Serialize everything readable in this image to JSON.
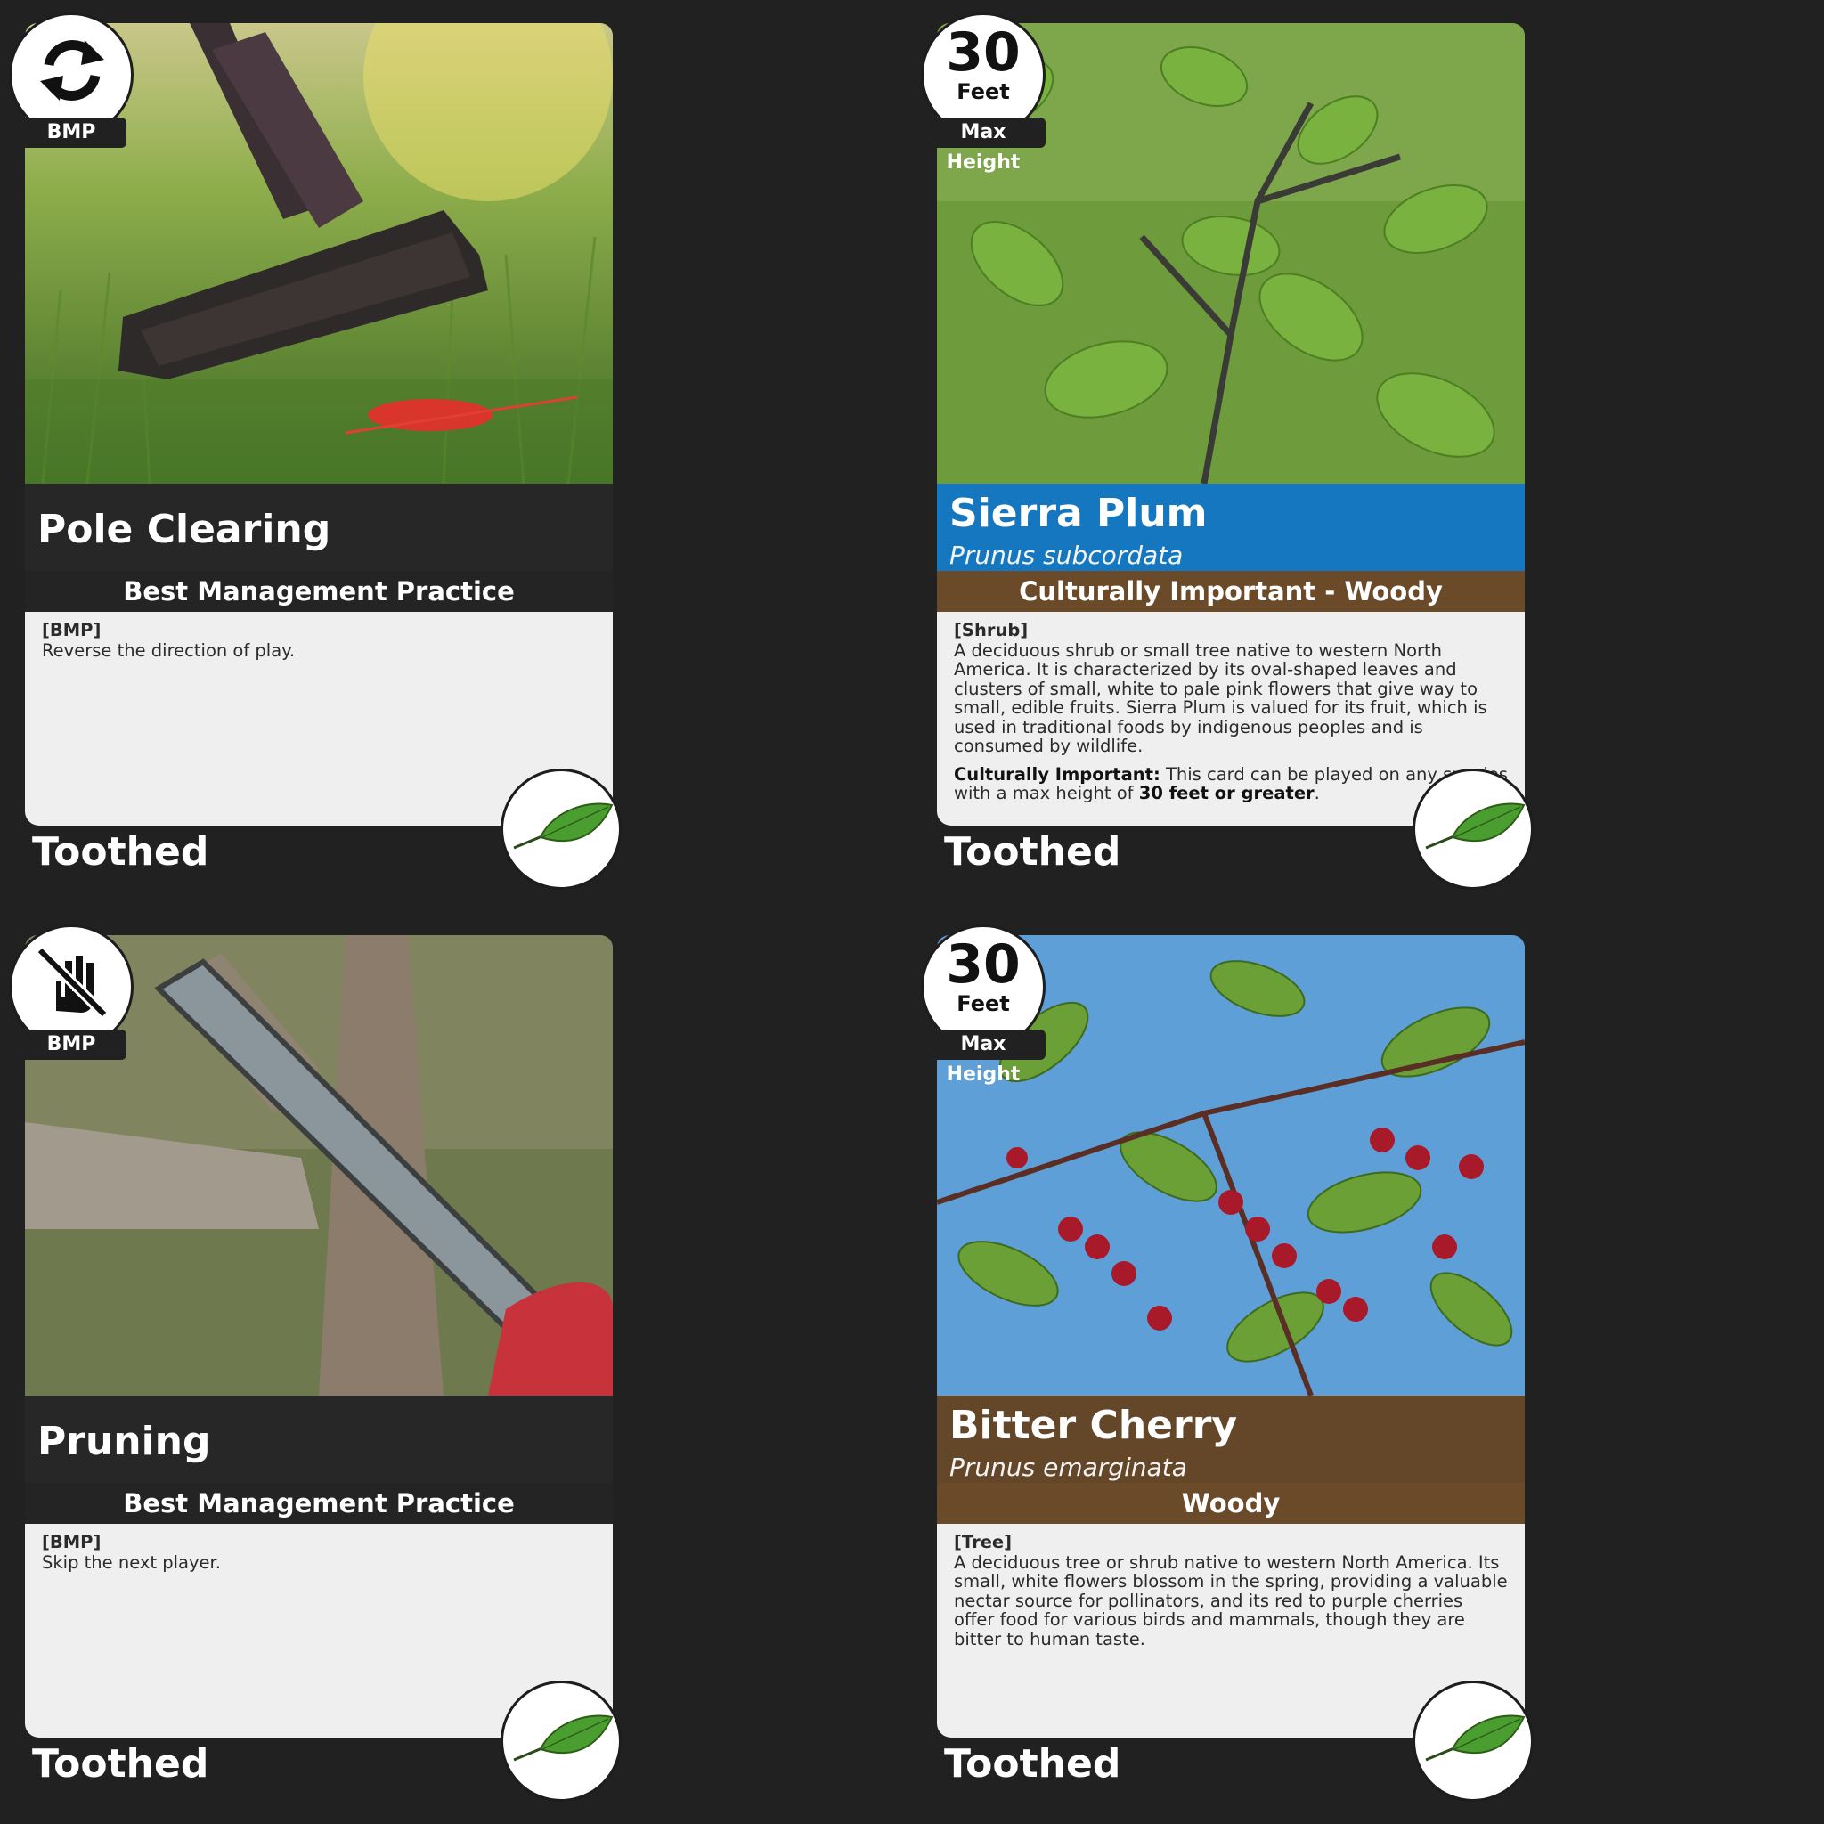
{
  "cards": [
    {
      "title": "Pole Clearing",
      "type_label": "Best Management Practice",
      "tag": "[BMP]",
      "text": "Reverse the direction of play.",
      "corner_icon": "reverse-arrows-icon",
      "corner_label": "BMP",
      "bottom_label": "Toothed"
    },
    {
      "title": "Sierra Plum",
      "scientific_name": "Prunus subcordata",
      "type_label": "Culturally Important - Woody",
      "tag": "[Shrub]",
      "text": "A deciduous shrub or small tree native to western North America. It is characterized by its oval-shaped leaves and clusters of small, white to pale pink flowers that give way to small, edible fruits. Sierra Plum is valued for its fruit, which is used in traditional foods by indigenous peoples and is consumed by wildlife.",
      "cultural_label": "Culturally Important:",
      "cultural_text": "This card can be played on any species with a max height of",
      "cultural_bold": "30 feet or greater",
      "cultural_end": ".",
      "height_value": "30",
      "height_unit": "Feet",
      "corner_label": "Max Height",
      "bottom_label": "Toothed"
    },
    {
      "title": "Pruning",
      "type_label": "Best Management Practice",
      "tag": "[BMP]",
      "text": "Skip the next player.",
      "corner_icon": "no-hand-icon",
      "corner_label": "BMP",
      "bottom_label": "Toothed"
    },
    {
      "title": "Bitter Cherry",
      "scientific_name": "Prunus emarginata",
      "type_label": "Woody",
      "tag": "[Tree]",
      "text": "A deciduous tree or shrub native to western North America. Its small, white flowers blossom in the spring, providing a valuable nectar source for pollinators, and its red to purple cherries offer food for various birds and mammals, though they are bitter to human taste.",
      "height_value": "30",
      "height_unit": "Feet",
      "corner_label": "Max Height",
      "bottom_label": "Toothed"
    }
  ],
  "colors": {
    "background": "#212121",
    "species_blue": "#1577bf",
    "woody_brown": "#6b4a2a",
    "card_text_panel": "#efefef",
    "leaf_green": "#4a9e2f"
  }
}
